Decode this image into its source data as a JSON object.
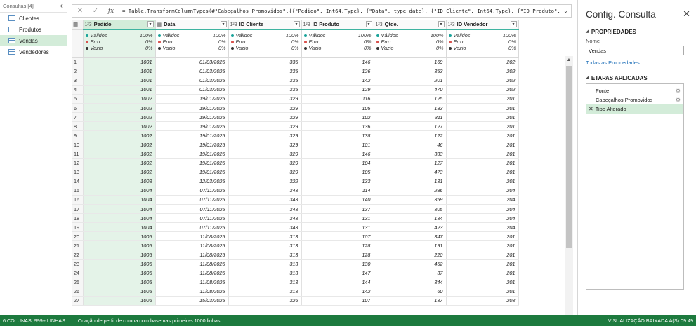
{
  "queries": {
    "header": "Consultas [4]",
    "items": [
      {
        "label": "Clientes",
        "active": false
      },
      {
        "label": "Produtos",
        "active": false
      },
      {
        "label": "Vendas",
        "active": true
      },
      {
        "label": "Vendedores",
        "active": false
      }
    ]
  },
  "formula": {
    "cancel": "✕",
    "commit": "✓",
    "fx": "fx",
    "text": "= Table.TransformColumnTypes(#\"Cabeçalhos Promovidos\",{{\"Pedido\", Int64.Type}, {\"Data\", type date}, {\"ID Cliente\", Int64.Type}, {\"ID Produto\","
  },
  "columns": [
    {
      "type": "1²3",
      "name": "Pedido",
      "selected": true
    },
    {
      "type": "▦",
      "name": "Data",
      "selected": false
    },
    {
      "type": "1²3",
      "name": "ID Cliente",
      "selected": false
    },
    {
      "type": "1²3",
      "name": "ID Produto",
      "selected": false
    },
    {
      "type": "1²3",
      "name": "Qtde.",
      "selected": false
    },
    {
      "type": "1²3",
      "name": "ID Vendedor",
      "selected": false
    }
  ],
  "profile": {
    "labels": [
      "Válidos",
      "Erro",
      "Vazio"
    ],
    "values": [
      "100%",
      "0%",
      "0%"
    ],
    "colors": [
      "#1aa39a",
      "#d9534f",
      "#333333"
    ]
  },
  "rows": [
    [
      "1001",
      "01/03/2025",
      "335",
      "146",
      "169",
      "202"
    ],
    [
      "1001",
      "01/03/2025",
      "335",
      "126",
      "353",
      "202"
    ],
    [
      "1001",
      "01/03/2025",
      "335",
      "142",
      "201",
      "202"
    ],
    [
      "1001",
      "01/03/2025",
      "335",
      "129",
      "470",
      "202"
    ],
    [
      "1002",
      "19/01/2025",
      "329",
      "116",
      "125",
      "201"
    ],
    [
      "1002",
      "19/01/2025",
      "329",
      "105",
      "183",
      "201"
    ],
    [
      "1002",
      "19/01/2025",
      "329",
      "102",
      "311",
      "201"
    ],
    [
      "1002",
      "19/01/2025",
      "329",
      "136",
      "127",
      "201"
    ],
    [
      "1002",
      "19/01/2025",
      "329",
      "138",
      "122",
      "201"
    ],
    [
      "1002",
      "19/01/2025",
      "329",
      "101",
      "46",
      "201"
    ],
    [
      "1002",
      "19/01/2025",
      "329",
      "146",
      "333",
      "201"
    ],
    [
      "1002",
      "19/01/2025",
      "329",
      "104",
      "127",
      "201"
    ],
    [
      "1002",
      "19/01/2025",
      "329",
      "105",
      "473",
      "201"
    ],
    [
      "1003",
      "12/03/2025",
      "322",
      "133",
      "131",
      "201"
    ],
    [
      "1004",
      "07/11/2025",
      "343",
      "114",
      "286",
      "204"
    ],
    [
      "1004",
      "07/11/2025",
      "343",
      "140",
      "359",
      "204"
    ],
    [
      "1004",
      "07/11/2025",
      "343",
      "137",
      "305",
      "204"
    ],
    [
      "1004",
      "07/11/2025",
      "343",
      "131",
      "134",
      "204"
    ],
    [
      "1004",
      "07/11/2025",
      "343",
      "131",
      "423",
      "204"
    ],
    [
      "1005",
      "11/08/2025",
      "313",
      "107",
      "347",
      "201"
    ],
    [
      "1005",
      "11/08/2025",
      "313",
      "128",
      "191",
      "201"
    ],
    [
      "1005",
      "11/08/2025",
      "313",
      "128",
      "220",
      "201"
    ],
    [
      "1005",
      "11/08/2025",
      "313",
      "130",
      "452",
      "201"
    ],
    [
      "1005",
      "11/08/2025",
      "313",
      "147",
      "37",
      "201"
    ],
    [
      "1005",
      "11/08/2025",
      "313",
      "144",
      "344",
      "201"
    ],
    [
      "1005",
      "11/08/2025",
      "313",
      "142",
      "60",
      "201"
    ],
    [
      "1006",
      "15/03/2025",
      "326",
      "107",
      "137",
      "203"
    ]
  ],
  "scrollbar": {
    "up": "▲"
  },
  "settings": {
    "title": "Config. Consulta",
    "close": "✕",
    "properties_heading": "PROPRIEDADES",
    "name_label": "Nome",
    "name_value": "Vendas",
    "all_properties": "Todas as Propriedades",
    "steps_heading": "ETAPAS APLICADAS",
    "steps": [
      {
        "label": "Fonte",
        "gear": true,
        "active": false
      },
      {
        "label": "Cabeçalhos Promovidos",
        "gear": true,
        "active": false
      },
      {
        "label": "Tipo Alterado",
        "gear": false,
        "active": true
      }
    ]
  },
  "status": {
    "left": "6 COLUNAS, 999+ LINHAS",
    "middle": "Criação de perfil de coluna com base nas primeiras 1000 linhas",
    "right": "VISUALIZAÇÃO BAIXADA À(S) 09:49"
  },
  "colors": {
    "accent": "#1d7a3e",
    "selected": "#d3ecd9",
    "header_rule": "#3fb3a0"
  }
}
